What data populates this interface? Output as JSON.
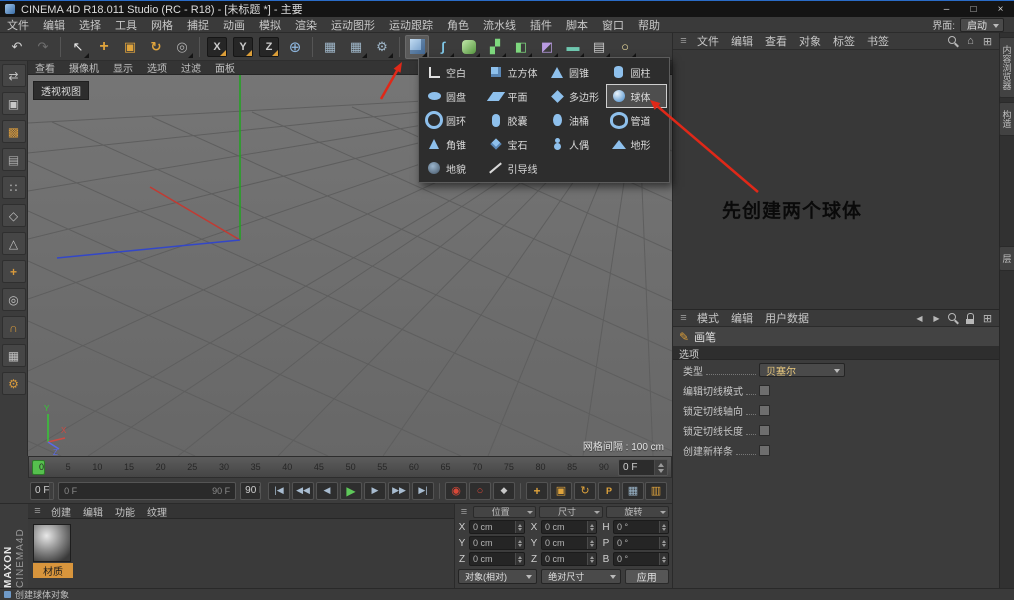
{
  "window": {
    "title": "CINEMA 4D R18.011 Studio (RC - R18) - [未标题 *] - 主要",
    "minimize": "–",
    "maximize": "□",
    "close": "×"
  },
  "menu_bar": {
    "items": [
      "文件",
      "编辑",
      "选择",
      "工具",
      "网格",
      "捕捉",
      "动画",
      "模拟",
      "渲染",
      "运动图形",
      "运动跟踪",
      "角色",
      "流水线",
      "插件",
      "脚本",
      "窗口",
      "帮助"
    ],
    "interface_label": "界面:",
    "interface_value": "启动"
  },
  "toolbar": {
    "buttons": [
      {
        "name": "undo-button",
        "glyph": "↶",
        "style": "color:#d2d2d2"
      },
      {
        "name": "redo-button",
        "glyph": "↷",
        "style": "color:#6f6f6f"
      },
      {
        "divider": "1",
        "ia": "false"
      },
      {
        "name": "live-selection-tool",
        "glyph": "↖",
        "style": "color:#ececec",
        "corner": "1"
      },
      {
        "name": "move-tool",
        "glyph": "+",
        "style": "color:#e0a43c;font-weight:bold;font-size:16px"
      },
      {
        "name": "scale-tool",
        "glyph": "▣",
        "style": "color:#e0a43c"
      },
      {
        "name": "rotate-tool",
        "glyph": "↻",
        "style": "color:#e0a43c;font-weight:bold"
      },
      {
        "name": "last-used-tool",
        "glyph": "◎",
        "style": "color:#b0b0b0",
        "corner": "1"
      },
      {
        "divider": "1",
        "ia": "false"
      },
      {
        "name": "lock-x-axis-button",
        "glyph": "X",
        "axis": "1"
      },
      {
        "name": "lock-y-axis-button",
        "glyph": "Y",
        "axis": "1"
      },
      {
        "name": "lock-z-axis-button",
        "glyph": "Z",
        "axis": "1"
      },
      {
        "name": "coordinate-system-button",
        "glyph": "⊕",
        "style": "color:#8fb8e0;font-size:15px"
      },
      {
        "divider": "1",
        "ia": "false"
      },
      {
        "name": "render-view-button",
        "glyph": "▦",
        "style": "color:#9fb6c8"
      },
      {
        "name": "render-picture-viewer-button",
        "glyph": "▦",
        "style": "color:#9fb6c8",
        "corner": "1"
      },
      {
        "name": "render-settings-button",
        "glyph": "⚙",
        "style": "color:#9fb6c8",
        "corner": "1"
      },
      {
        "divider": "1",
        "ia": "false"
      },
      {
        "name": "add-primitive-button",
        "glyph": "",
        "cube": "1",
        "pressed": "1",
        "corner": "1"
      },
      {
        "name": "add-spline-button",
        "glyph": "∫",
        "style": "color:#7fc8e8;font-weight:bold",
        "corner": "1"
      },
      {
        "name": "add-subdivision-surface-button",
        "glyph": "",
        "gcube": "1",
        "corner": "1"
      },
      {
        "name": "add-array-button",
        "glyph": "▞",
        "style": "color:#7ed87e",
        "corner": "1"
      },
      {
        "name": "add-boole-button",
        "glyph": "◧",
        "style": "color:#7ed87e",
        "corner": "1"
      },
      {
        "name": "add-deformer-button",
        "glyph": "◩",
        "style": "color:#b89ae0",
        "corner": "1"
      },
      {
        "name": "add-environment-button",
        "glyph": "▬",
        "style": "color:#6fc8b0",
        "corner": "1"
      },
      {
        "name": "add-camera-button",
        "glyph": "▤",
        "style": "color:#c8c8c8",
        "corner": "1"
      },
      {
        "name": "add-light-button",
        "glyph": "○",
        "style": "color:#f0e0a0",
        "corner": "1"
      }
    ]
  },
  "left_toolbar": {
    "buttons": [
      {
        "name": "make-editable-button",
        "glyph": "⇄",
        "style": "color:#c0c0c0"
      },
      {
        "name": "model-mode-button",
        "glyph": "▣",
        "style": "color:#c8c8c8"
      },
      {
        "name": "texture-mode-button",
        "glyph": "▩",
        "style": "color:#d89a3c"
      },
      {
        "name": "workplane-mode-button",
        "glyph": "▤",
        "style": "color:#aaaaaa"
      },
      {
        "name": "points-mode-button",
        "glyph": "∷",
        "style": "color:#c0c0c0"
      },
      {
        "name": "edges-mode-button",
        "glyph": "◇",
        "style": "color:#c0c0c0"
      },
      {
        "name": "polygons-mode-button",
        "glyph": "△",
        "style": "color:#c0c0c0"
      },
      {
        "name": "enable-axis-button",
        "glyph": "+",
        "style": "color:#d89a3c;font-weight:bold"
      },
      {
        "name": "viewport-solo-button",
        "glyph": "◎",
        "style": "color:#c0c0c0"
      },
      {
        "name": "enable-snap-button",
        "glyph": "∩",
        "style": "color:#d89a3c;font-weight:bold"
      },
      {
        "name": "workplane-snap-button",
        "glyph": "▦",
        "style": "color:#c0c0c0"
      },
      {
        "name": "quantize-button",
        "glyph": "⚙",
        "style": "color:#d89a3c"
      }
    ]
  },
  "viewport": {
    "menu_items": [
      "查看",
      "摄像机",
      "显示",
      "选项",
      "过滤",
      "面板"
    ],
    "view_label": "透视视图",
    "grid_info": "网格间隔 : 100 cm",
    "axis_labels": {
      "x": "X",
      "y": "Y",
      "z": "Z"
    }
  },
  "popup": {
    "items": [
      {
        "label": "空白",
        "icon": "axis"
      },
      {
        "label": "立方体",
        "icon": "cube"
      },
      {
        "label": "圆锥",
        "icon": "cone"
      },
      {
        "label": "圆柱",
        "icon": "cylinder"
      },
      {
        "label": "圆盘",
        "icon": "disc"
      },
      {
        "label": "平面",
        "icon": "plane"
      },
      {
        "label": "多边形",
        "icon": "polygon"
      },
      {
        "label": "球体",
        "icon": "sphere",
        "hl": "1"
      },
      {
        "label": "圆环",
        "icon": "torus"
      },
      {
        "label": "胶囊",
        "icon": "capsule"
      },
      {
        "label": "油桶",
        "icon": "oiltank"
      },
      {
        "label": "管道",
        "icon": "tube"
      },
      {
        "label": "角锥",
        "icon": "pyramid"
      },
      {
        "label": "宝石",
        "icon": "gem"
      },
      {
        "label": "人偶",
        "icon": "figure"
      },
      {
        "label": "地形",
        "icon": "landscape"
      },
      {
        "label": "地貌",
        "icon": "relief"
      },
      {
        "label": "引导线",
        "icon": "guide"
      }
    ]
  },
  "annotation": {
    "text": "先创建两个球体"
  },
  "object_manager": {
    "menus": [
      "文件",
      "编辑",
      "查看",
      "对象",
      "标签",
      "书签"
    ],
    "icons": [
      {
        "name": "search-icon",
        "k": "mag"
      },
      {
        "name": "home-icon",
        "k": "home"
      },
      {
        "name": "layout-grid-icon",
        "k": "grid"
      }
    ],
    "side_tabs": [
      {
        "label": "内容浏览器"
      },
      {
        "label": "构造"
      },
      {
        "label": "层",
        "layer": "1"
      }
    ]
  },
  "attribute_manager": {
    "menus": [
      "模式",
      "编辑",
      "用户数据"
    ],
    "icons": [
      {
        "name": "history-back-icon",
        "k": "back"
      },
      {
        "name": "history-forward-icon",
        "k": "fwd"
      },
      {
        "name": "search-icon",
        "k": "mag"
      },
      {
        "name": "lock-icon",
        "k": "lock"
      },
      {
        "name": "layout-grid-icon",
        "k": "grid"
      }
    ],
    "tool_name": "画笔",
    "section": "选项",
    "type_label": "类型",
    "type_value": "贝塞尔",
    "checks": [
      {
        "label": "编辑切线模式"
      },
      {
        "label": "锁定切线轴向"
      },
      {
        "label": "锁定切线长度"
      },
      {
        "label": "创建新样条"
      }
    ]
  },
  "timeline": {
    "ticks": [
      "0",
      "5",
      "10",
      "15",
      "20",
      "25",
      "30",
      "35",
      "40",
      "45",
      "50",
      "55",
      "60",
      "65",
      "70",
      "75",
      "80",
      "85",
      "90"
    ],
    "tail": "0 F"
  },
  "playback": {
    "current": "0 F",
    "range_start": "0 F",
    "range_end": "90 F",
    "max": "90 F",
    "buttons": [
      {
        "name": "goto-start-button",
        "glyph": "|◀"
      },
      {
        "name": "prev-key-button",
        "glyph": "◀◀"
      },
      {
        "name": "prev-frame-button",
        "glyph": "◀"
      },
      {
        "name": "play-button",
        "glyph": "▶",
        "style": "color:#5ec85a;font-size:12px"
      },
      {
        "name": "next-frame-button",
        "glyph": "▶"
      },
      {
        "name": "next-key-button",
        "glyph": "▶▶"
      },
      {
        "name": "goto-end-button",
        "glyph": "▶|"
      },
      {
        "divider": "1",
        "ia": "false"
      },
      {
        "name": "record-keyframe-button",
        "glyph": "◉",
        "style": "color:#d84838;font-size:11px"
      },
      {
        "name": "autokey-button",
        "glyph": "○",
        "style": "color:#d84838;font-size:11px"
      },
      {
        "name": "keyframe-selection-button",
        "glyph": "◆",
        "style": "color:#c8c8c8"
      },
      {
        "divider": "1",
        "ia": "false"
      },
      {
        "name": "record-position-toggle",
        "glyph": "+",
        "style": "color:#e0a43c;font-weight:bold;font-size:12px"
      },
      {
        "name": "record-scale-toggle",
        "glyph": "▣",
        "style": "color:#e0a43c;font-size:11px"
      },
      {
        "name": "record-rotation-toggle",
        "glyph": "↻",
        "style": "color:#e0a43c;font-size:11px"
      },
      {
        "name": "record-parameter-toggle",
        "glyph": "P",
        "style": "color:#e0a43c;font-weight:bold"
      },
      {
        "name": "record-pla-toggle",
        "glyph": "▦",
        "style": "color:#9ab4c8;font-size:11px"
      },
      {
        "name": "timeline-settings-button",
        "glyph": "▥",
        "style": "color:#e0a43c;font-size:11px",
        "right": "1"
      }
    ]
  },
  "material_manager": {
    "menus": [
      "创建",
      "编辑",
      "功能",
      "纹理"
    ],
    "materials": [
      {
        "name": "材质"
      }
    ]
  },
  "coordinates": {
    "headers": [
      "位置",
      "尺寸",
      "旋转"
    ],
    "fields": [
      {
        "l": "X",
        "v": "0 cm"
      },
      {
        "l": "X",
        "v": "0 cm"
      },
      {
        "l": "H",
        "v": "0 °"
      },
      {
        "l": "Y",
        "v": "0 cm"
      },
      {
        "l": "Y",
        "v": "0 cm"
      },
      {
        "l": "P",
        "v": "0 °"
      },
      {
        "l": "Z",
        "v": "0 cm"
      },
      {
        "l": "Z",
        "v": "0 cm"
      },
      {
        "l": "B",
        "v": "0 °"
      }
    ],
    "mode_value": "对象(相对)",
    "size_value": "绝对尺寸",
    "apply_label": "应用"
  },
  "branding": {
    "line1": "MAXON",
    "line2": "CINEMA4D"
  },
  "status_bar": {
    "text": "创建球体对象"
  }
}
